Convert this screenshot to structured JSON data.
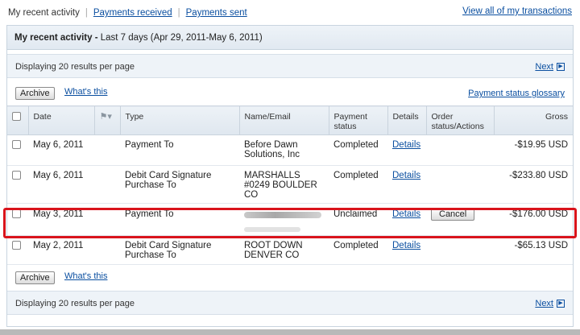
{
  "tabs": {
    "current": "My recent activity",
    "received": "Payments received",
    "sent": "Payments sent",
    "view_all": "View all of my transactions"
  },
  "panel": {
    "title": "My recent activity -",
    "range": "Last 7 days (Apr 29, 2011-May 6, 2011)",
    "displaying": "Displaying 20 results per page",
    "next": "Next",
    "archive": "Archive",
    "whats_this": "What's this",
    "glossary": "Payment status glossary"
  },
  "columns": {
    "date": "Date",
    "type": "Type",
    "name": "Name/Email",
    "status": "Payment status",
    "details": "Details",
    "order": "Order status/Actions",
    "gross": "Gross"
  },
  "rows": [
    {
      "date": "May 6, 2011",
      "type": "Payment To",
      "name": "Before Dawn Solutions, Inc",
      "status": "Completed",
      "details": "Details",
      "action": "",
      "gross": "-$19.95 USD"
    },
    {
      "date": "May 6, 2011",
      "type": "Debit Card Signature Purchase To",
      "name": "MARSHALLS #0249 BOULDER CO",
      "status": "Completed",
      "details": "Details",
      "action": "",
      "gross": "-$233.80 USD"
    },
    {
      "date": "May 3, 2011",
      "type": "Payment To",
      "name": "",
      "status": "Unclaimed",
      "details": "Details",
      "action": "Cancel",
      "gross": "-$176.00 USD"
    },
    {
      "date": "May 2, 2011",
      "type": "Debit Card Signature Purchase To",
      "name": "ROOT DOWN DENVER CO",
      "status": "Completed",
      "details": "Details",
      "action": "",
      "gross": "-$65.13 USD"
    }
  ],
  "icons": {
    "flag": "flag-icon",
    "next_arrow": "next-arrow-icon"
  },
  "colors": {
    "link": "#0b4fa0",
    "highlight": "#d9141c",
    "header_bg": "#e1e9f1"
  }
}
